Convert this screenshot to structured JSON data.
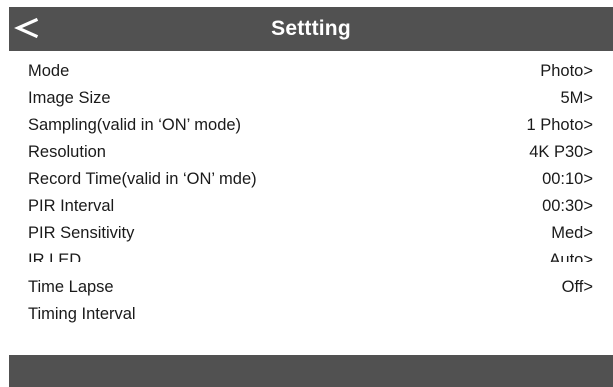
{
  "header": {
    "title": "Settting",
    "back_icon": "chevron-left-icon"
  },
  "settings": [
    {
      "label": "Mode",
      "value": "Photo>"
    },
    {
      "label": "Image Size",
      "value": "5M>"
    },
    {
      "label": "Sampling(valid in ‘ON’ mode)",
      "value": "1 Photo>"
    },
    {
      "label": "Resolution",
      "value": "4K P30>"
    },
    {
      "label": "Record Time(valid in ‘ON’ mde)",
      "value": "00:10>"
    },
    {
      "label": "PIR Interval",
      "value": "00:30>"
    },
    {
      "label": "PIR Sensitivity",
      "value": "Med>"
    },
    {
      "label": "IR LED",
      "value": "Auto>"
    },
    {
      "label": "Time Lapse",
      "value": "Off>"
    },
    {
      "label": "Timing Interval",
      "value": ""
    }
  ],
  "colors": {
    "bar": "#515151",
    "background": "#ffffff",
    "text": "#1a1a1a"
  }
}
